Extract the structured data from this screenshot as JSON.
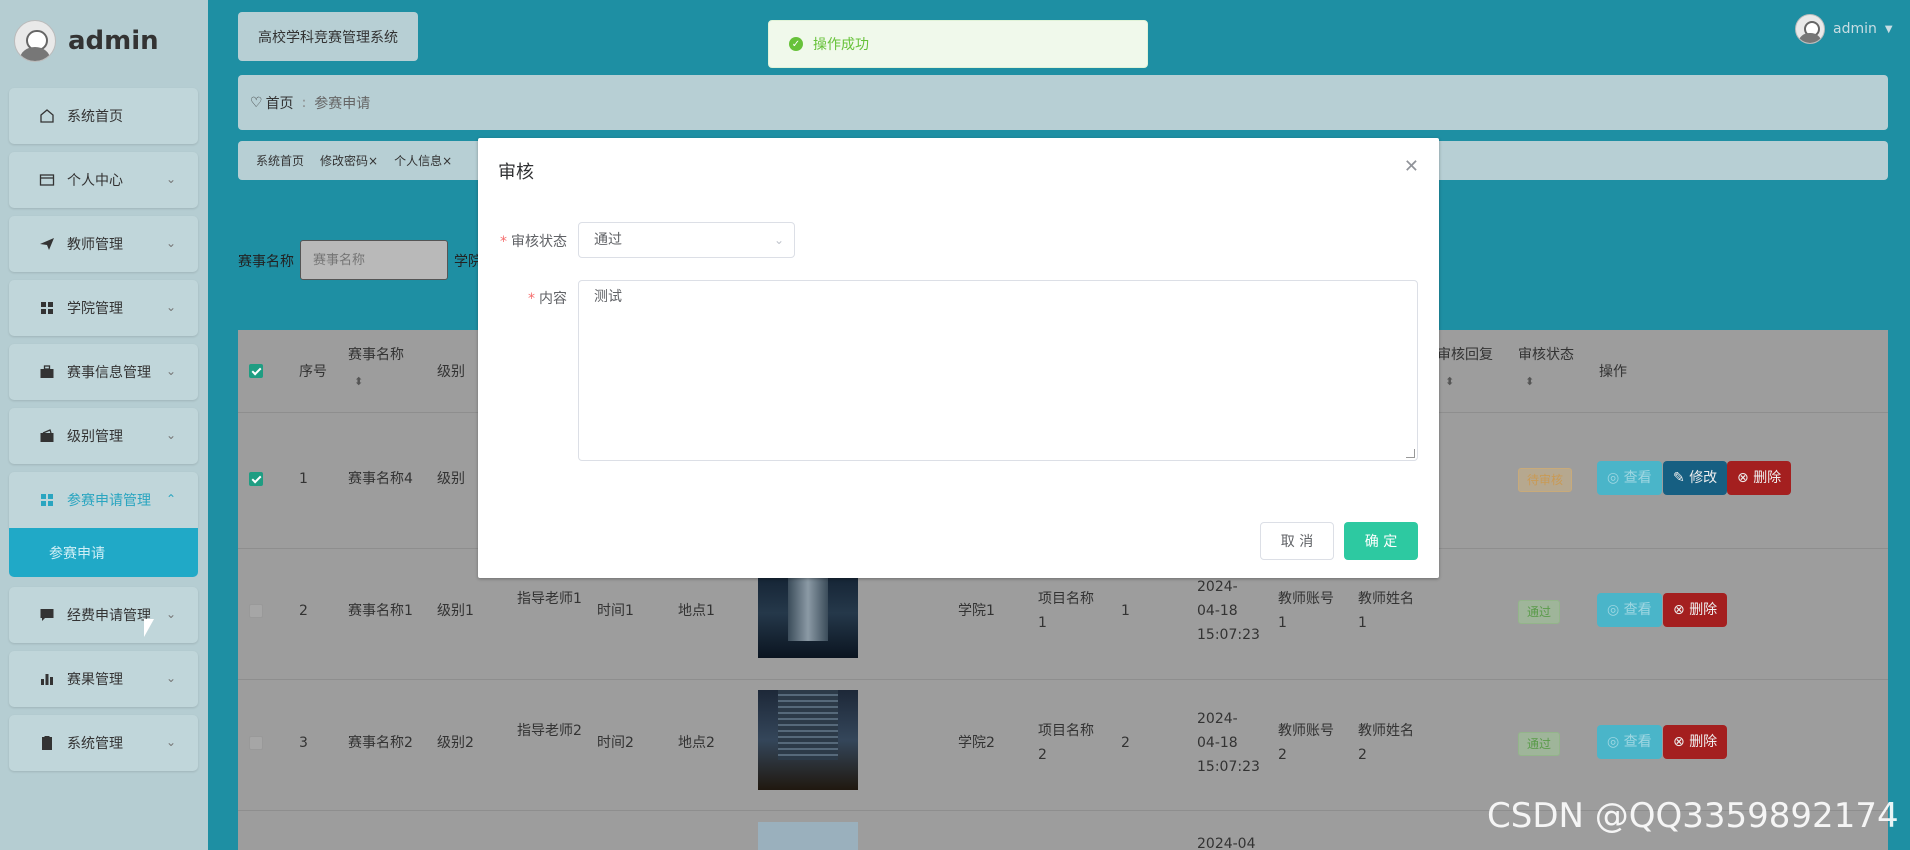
{
  "app": {
    "brand": "admin",
    "system_title": "高校学科竞赛管理系统",
    "user_name": "admin"
  },
  "sidebar": {
    "items": [
      {
        "label": "系统首页",
        "icon": "home-icon"
      },
      {
        "label": "个人中心",
        "icon": "card-icon"
      },
      {
        "label": "教师管理",
        "icon": "send-icon"
      },
      {
        "label": "学院管理",
        "icon": "grid-icon"
      },
      {
        "label": "赛事信息管理",
        "icon": "briefcase-icon"
      },
      {
        "label": "级别管理",
        "icon": "wallet-icon"
      },
      {
        "label": "参赛申请管理",
        "icon": "grid-icon",
        "open": true
      },
      {
        "label": "经费申请管理",
        "icon": "chat-icon"
      },
      {
        "label": "赛果管理",
        "icon": "bar-chart-icon"
      },
      {
        "label": "系统管理",
        "icon": "clipboard-icon"
      }
    ],
    "active_sub": "参赛申请"
  },
  "breadcrumb": {
    "home": "首页",
    "current": "参赛申请"
  },
  "tags": [
    "系统首页",
    "修改密码",
    "个人信息"
  ],
  "search": {
    "label": "赛事名称",
    "placeholder": "赛事名称",
    "label2": "学院"
  },
  "table": {
    "headers": {
      "index": "序号",
      "name": "赛事名称",
      "level": "级别",
      "review_reply": "审核回复",
      "review_status": "审核状态",
      "actions": "操作"
    },
    "rows": [
      {
        "index": "1",
        "name": "赛事名称4",
        "level": "级别",
        "status": "待审核",
        "checked": true
      },
      {
        "index": "2",
        "name": "赛事名称1",
        "level": "级别1",
        "teacher": "指导老师1",
        "time": "时间1",
        "place": "地点1",
        "college": "学院1",
        "project": "项目名称1",
        "count": "1",
        "date": "2024-04-18 15:07:23",
        "account": "教师账号1",
        "tname": "教师姓名1",
        "status": "通过"
      },
      {
        "index": "3",
        "name": "赛事名称2",
        "level": "级别2",
        "teacher": "指导老师2",
        "time": "时间2",
        "place": "地点2",
        "college": "学院2",
        "project": "项目名称2",
        "count": "2",
        "date": "2024-04-18 15:07:23",
        "account": "教师账号2",
        "tname": "教师姓名2",
        "status": "通过"
      }
    ],
    "partial_date": "2024-04",
    "btn_view": "查看",
    "btn_edit": "修改",
    "btn_delete": "删除"
  },
  "toast": {
    "message": "操作成功"
  },
  "dialog": {
    "title": "审核",
    "status_label": "审核状态",
    "status_value": "通过",
    "content_label": "内容",
    "content_value": "测试",
    "cancel": "取 消",
    "confirm": "确 定"
  },
  "watermark": "CSDN @QQ3359892174"
}
